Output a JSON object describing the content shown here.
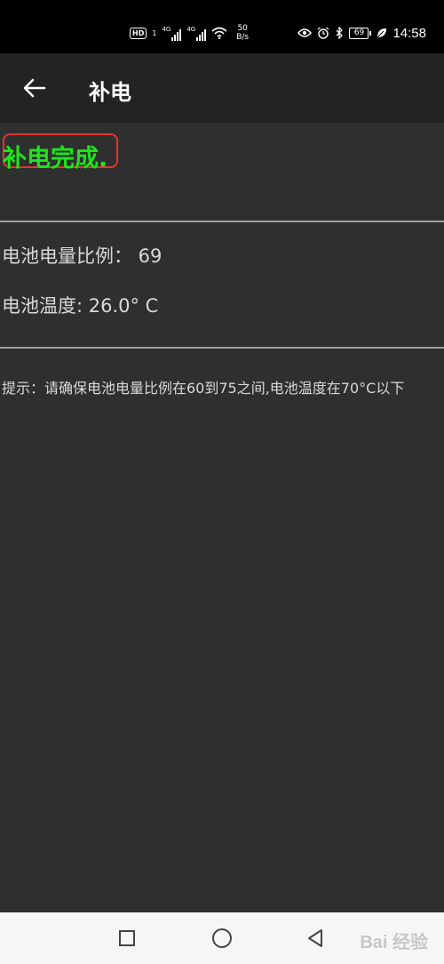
{
  "status_bar": {
    "hd": "HD",
    "sim1": "1",
    "net1": "4G",
    "net2": "4G",
    "speed_value": "50",
    "speed_unit": "B/s",
    "battery": "69",
    "time": "14:58"
  },
  "app_bar": {
    "title": "补电"
  },
  "result": {
    "message": "补电完成.",
    "color": "#1ce61c"
  },
  "battery_info": {
    "level_line": "电池电量比例：  69",
    "temp_line": "电池温度: 26.0° C"
  },
  "hint": {
    "text": "提示：请确保电池电量比例在60到75之间,电池温度在70°C以下"
  },
  "watermark": {
    "text": "Bai 经验"
  },
  "colors": {
    "background": "#2f2f2f",
    "app_bar": "#232323",
    "highlight_border": "#e0352f"
  }
}
